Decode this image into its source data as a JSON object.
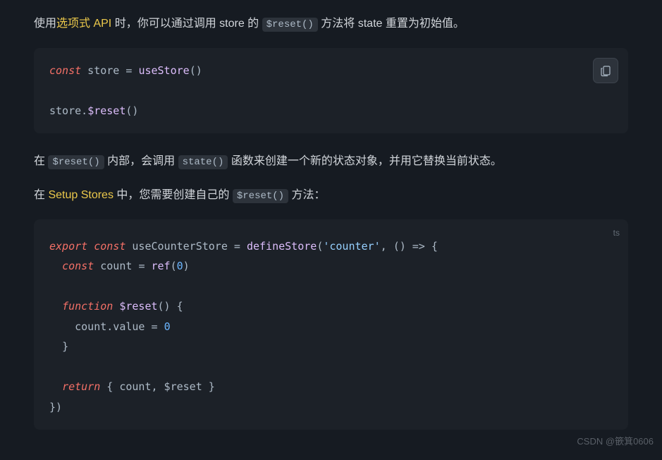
{
  "para1": {
    "seg1": "使用",
    "link1": "选项式 API",
    "seg2": " 时，你可以通过调用 store 的 ",
    "code1": "$reset()",
    "seg3": " 方法将 state 重置为初始值。"
  },
  "code1": {
    "kw_const": "const",
    "var_store": " store ",
    "op_eq": "=",
    "sp": " ",
    "fn_use": "useStore",
    "paren": "()",
    "line2_store": "store.",
    "line2_fn": "$reset",
    "line2_paren": "()"
  },
  "para2": {
    "seg1": "在 ",
    "code1": "$reset()",
    "seg2": " 内部，会调用 ",
    "code2": "state()",
    "seg3": " 函数来创建一个新的状态对象，并用它替换当前状态。"
  },
  "para3": {
    "seg1": "在 ",
    "link1": "Setup Stores",
    "seg2": " 中，您需要创建自己的 ",
    "code1": "$reset()",
    "seg3": " 方法："
  },
  "code2": {
    "lang": "ts",
    "l1": {
      "export": "export",
      "const": "const",
      "name": " useCounterStore ",
      "eq": "=",
      "define": "defineStore",
      "open": "(",
      "str": "'counter'",
      "comma": ", ",
      "arrow_open": "() ",
      "arrow": "=>",
      "brace": " {"
    },
    "l2": {
      "indent": "  ",
      "const": "const",
      "name": " count ",
      "eq": "=",
      "sp": " ",
      "ref": "ref",
      "open": "(",
      "zero": "0",
      "close": ")"
    },
    "l4": {
      "indent": "  ",
      "function": "function",
      "name": " $reset",
      "paren": "() ",
      "brace": "{"
    },
    "l5": {
      "indent": "    ",
      "prop": "count.value ",
      "eq": "=",
      "sp": " ",
      "zero": "0"
    },
    "l6": {
      "indent": "  ",
      "brace": "}"
    },
    "l8": {
      "indent": "  ",
      "return": "return",
      "sp": " ",
      "obj": "{ count, $reset }"
    },
    "l9": {
      "close": "})"
    }
  },
  "watermark": "CSDN @篏箕0606"
}
